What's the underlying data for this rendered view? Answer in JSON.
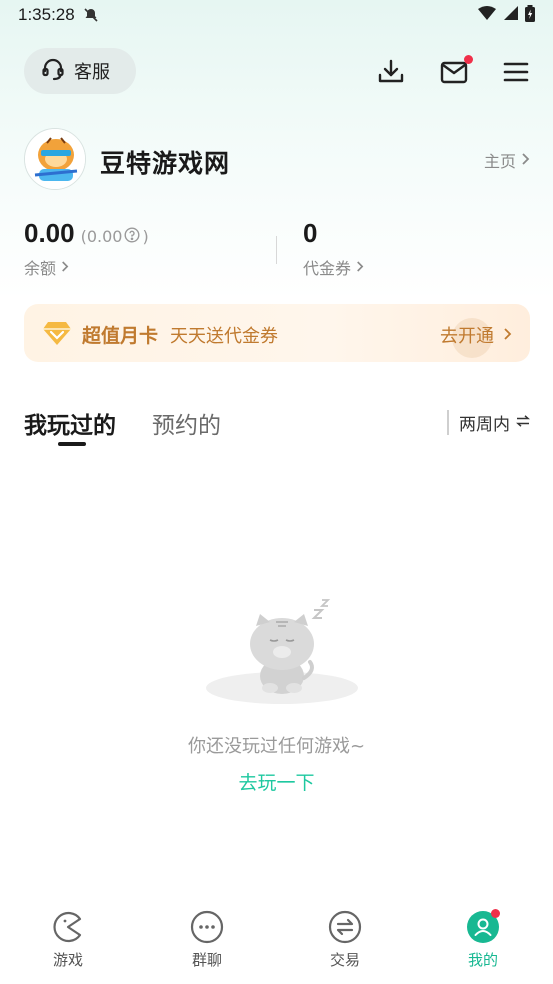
{
  "status_bar": {
    "time": "1:35:28"
  },
  "header": {
    "service_label": "客服"
  },
  "profile": {
    "site_name": "豆特游戏网",
    "home_link": "主页"
  },
  "stats": {
    "balance_value": "0.00",
    "balance_sub": "(0.00",
    "balance_sub_end": ")",
    "balance_label": "余额",
    "voucher_value": "0",
    "voucher_label": "代金券"
  },
  "vip_card": {
    "title": "超值月卡",
    "subtitle": "天天送代金券",
    "cta": "去开通"
  },
  "tabs": [
    {
      "label": "我玩过的",
      "active": true
    },
    {
      "label": "预约的",
      "active": false
    }
  ],
  "filter": {
    "label": "两周内",
    "icon": "swap-icon"
  },
  "empty_state": {
    "message": "你还没玩过任何游戏~",
    "action": "去玩一下"
  },
  "bottom_nav": [
    {
      "label": "游戏",
      "icon": "pacman-icon"
    },
    {
      "label": "群聊",
      "icon": "chat-dots-icon"
    },
    {
      "label": "交易",
      "icon": "exchange-icon"
    },
    {
      "label": "我的",
      "icon": "user-icon",
      "active": true
    }
  ],
  "colors": {
    "accent": "#18b892",
    "vip_text": "#c07a2f",
    "badge": "#f0304a"
  }
}
